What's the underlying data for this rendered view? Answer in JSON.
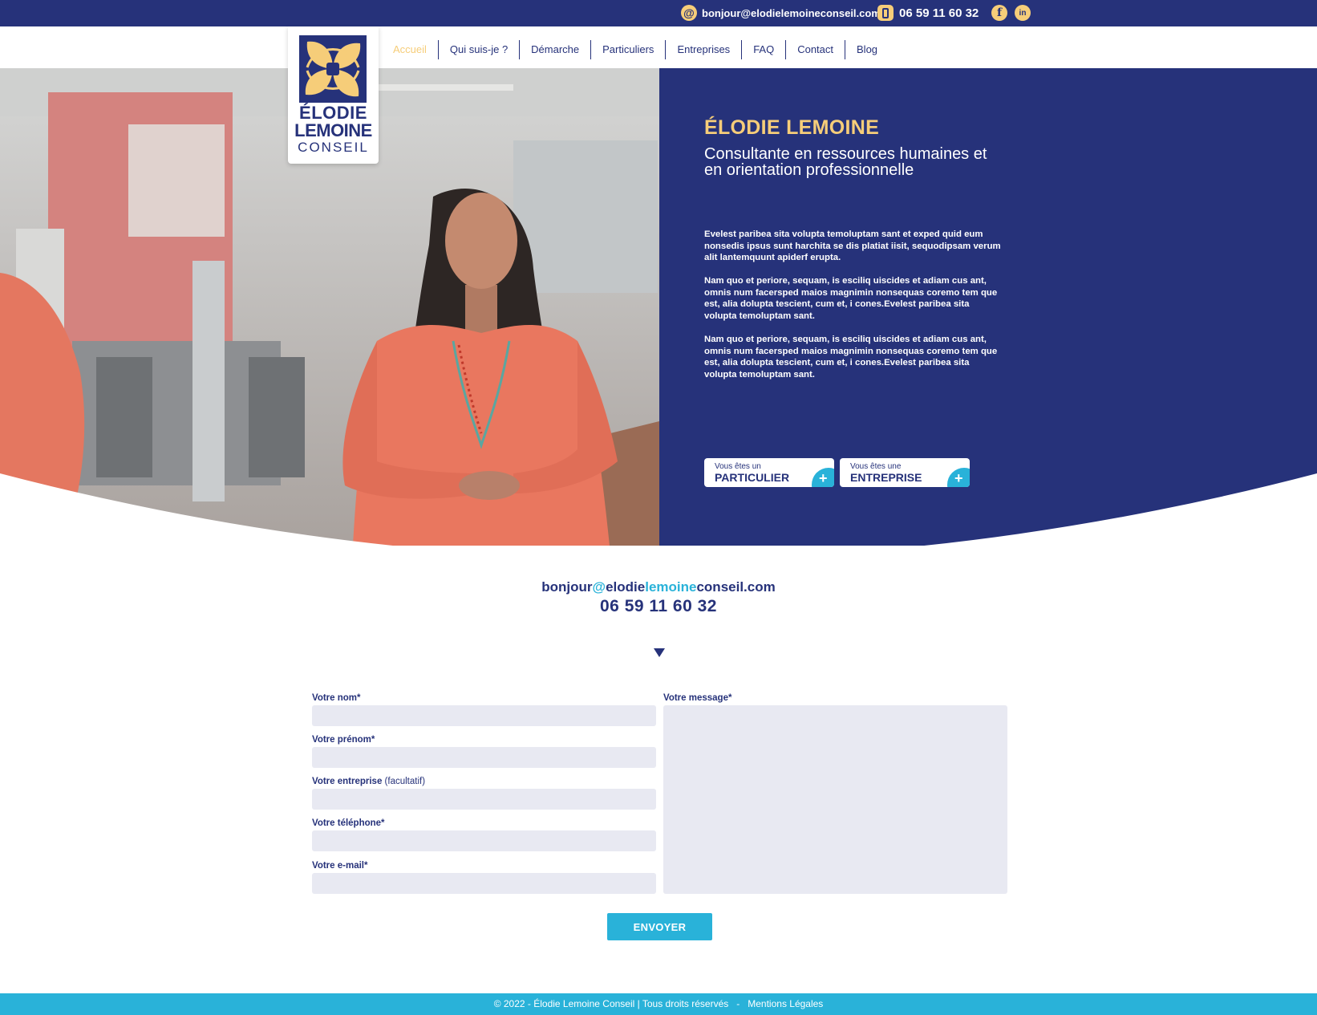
{
  "topbar": {
    "email": "bonjour@elodielemoineconseil.com",
    "phone": "06 59 11 60 32",
    "email_icon": "at-icon",
    "phone_icon": "phone-icon",
    "social": [
      "facebook-icon",
      "linkedin-icon"
    ]
  },
  "nav": {
    "items": [
      "Accueil",
      "Qui suis-je ?",
      "Démarche",
      "Particuliers",
      "Entreprises",
      "FAQ",
      "Contact",
      "Blog"
    ],
    "active": "Accueil"
  },
  "logo": {
    "line1": "ÉLODIE",
    "line2": "LEMOINE",
    "line3": "CONSEIL"
  },
  "hero": {
    "name": "ÉLODIE LEMOINE",
    "subtitle": "Consultante en ressources humaines et en orientation professionnelle",
    "paragraphs": [
      "Evelest paribea sita volupta temoluptam sant et exped quid eum nonsedis ipsus sunt harchita se dis platiat iisit, sequodipsam verum alit lantemquunt apiderf erupta.",
      "Nam quo et periore, sequam, is esciliq uiscides et adiam cus ant, omnis num facersped maios magnimin nonsequas coremo tem que est, alia dolupta tescient, cum et, i cones.Evelest paribea sita volupta temoluptam sant.",
      "Nam quo et periore, sequam, is esciliq uiscides et adiam cus ant, omnis num facersped maios magnimin nonsequas coremo tem que est, alia dolupta tescient, cum et, i cones.Evelest paribea sita volupta temoluptam sant."
    ],
    "cta_particulier": {
      "small": "Vous êtes un",
      "big": "PARTICULIER"
    },
    "cta_entreprise": {
      "small": "Vous êtes une",
      "big": "ENTREPRISE"
    },
    "cta_icon": "plus-icon"
  },
  "contact": {
    "email_parts": [
      "bonjour",
      "@",
      "elodie",
      "lemoine",
      "conseil.com"
    ],
    "phone": "06 59 11 60 32"
  },
  "form": {
    "nom_label": "Votre nom*",
    "prenom_label": "Votre prénom*",
    "entreprise_label": "Votre entreprise",
    "entreprise_optional": " (facultatif)",
    "telephone_label": "Votre téléphone*",
    "email_label": "Votre e-mail*",
    "message_label": "Votre message*",
    "nom_value": "",
    "prenom_value": "",
    "entreprise_value": "",
    "telephone_value": "",
    "email_value": "",
    "message_value": "",
    "submit_label": "ENVOYER"
  },
  "footer": {
    "copyright": "© 2022 - Élodie Lemoine Conseil | Tous droits réservés",
    "separator": "   -   ",
    "legal": "Mentions Légales"
  },
  "colors": {
    "navy": "#26327a",
    "yellow": "#f6cd79",
    "cyan": "#29b2d9",
    "input_bg": "#e8e9f2"
  }
}
